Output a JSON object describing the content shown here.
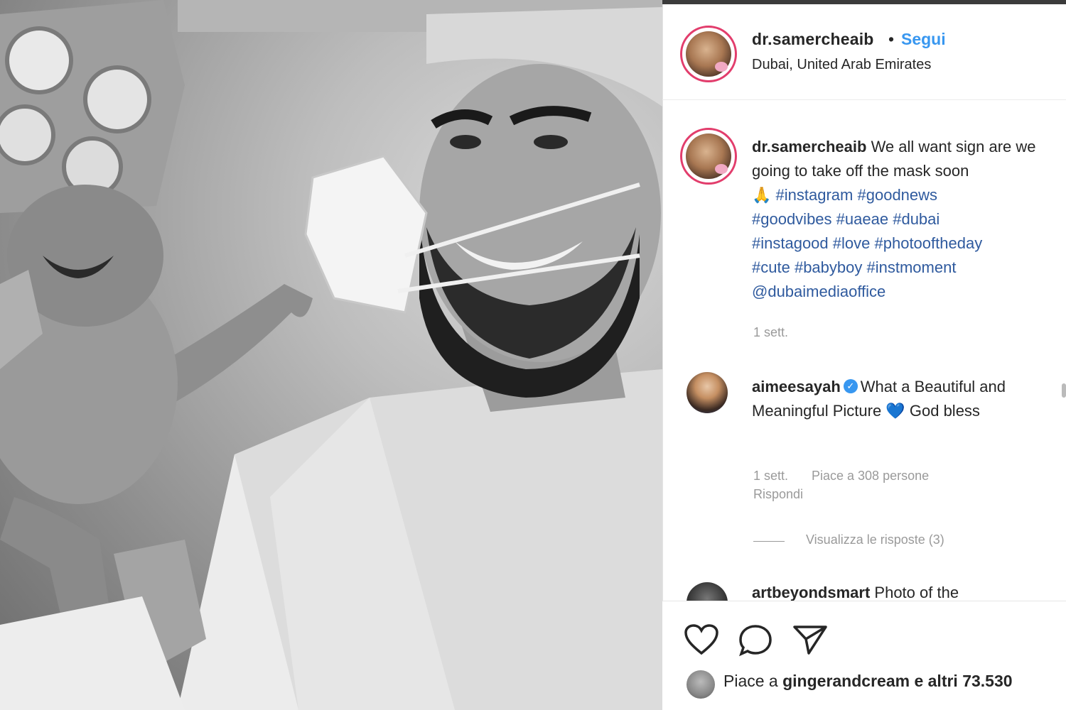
{
  "post": {
    "username": "dr.samercheaib",
    "separator": "•",
    "follow_label": "Segui",
    "location": "Dubai, United Arab Emirates"
  },
  "caption": {
    "username": "dr.samercheaib",
    "text": "We all want sign are we going to take off the mask soon",
    "emoji": "🙏",
    "hashtags": [
      "#instagram",
      "#goodnews",
      "#goodvibes",
      "#uaeae",
      "#dubai",
      "#instagood",
      "#love",
      "#photooftheday",
      "#cute",
      "#babyboy",
      "#instmoment"
    ],
    "mention": "@dubaimediaoffice",
    "time": "1 sett."
  },
  "comments": [
    {
      "username": "aimeesayah",
      "verified": true,
      "text_before": "What a Beautiful and Meaningful Picture",
      "emoji": "💙",
      "text_after": "God bless",
      "time": "1 sett.",
      "likes_text": "Piace a 308 persone",
      "reply_label": "Rispondi",
      "view_replies": "Visualizza le risposte (3)"
    },
    {
      "username": "artbeyondsmart",
      "text": "Photo of the"
    }
  ],
  "actions": {
    "icons": [
      "heart-icon",
      "comment-icon",
      "share-icon"
    ]
  },
  "likes": {
    "prefix": "Piace a",
    "user": "gingerandcream",
    "suffix": "e altri 73.530"
  },
  "colors": {
    "link": "#3897f0",
    "hashtag": "#2f5a9e",
    "muted": "#9a9a9a",
    "story_ring": "#e23d6c"
  }
}
